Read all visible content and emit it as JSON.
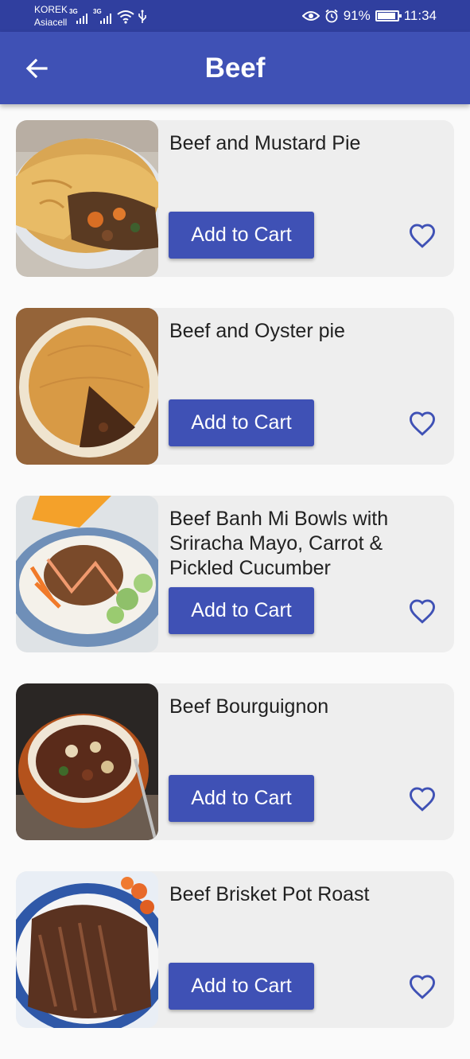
{
  "status_bar": {
    "carrier_1": "KOREK",
    "carrier_2": "Asiacell",
    "network_type": "3G",
    "battery": "91%",
    "battery_level": 0.91,
    "time": "11:34",
    "icons": [
      "signal-icon",
      "wifi-icon",
      "usb-icon",
      "eye-icon",
      "alarm-icon",
      "battery-icon"
    ]
  },
  "app_bar": {
    "title": "Beef",
    "back_icon": "arrow-left-icon"
  },
  "colors": {
    "primary": "#3f51b5",
    "primary_dark": "#303f9f",
    "card_bg": "#eeeeee",
    "page_bg": "#fafafa"
  },
  "meals": [
    {
      "name": "Beef and Mustard Pie",
      "button": "Add to Cart",
      "favorite_icon": "heart-outline-icon"
    },
    {
      "name": "Beef and Oyster pie",
      "button": "Add to Cart",
      "favorite_icon": "heart-outline-icon"
    },
    {
      "name": "Beef Banh Mi Bowls with Sriracha Mayo, Carrot & Pickled Cucumber",
      "button": "Add to Cart",
      "favorite_icon": "heart-outline-icon"
    },
    {
      "name": "Beef Bourguignon",
      "button": "Add to Cart",
      "favorite_icon": "heart-outline-icon"
    },
    {
      "name": "Beef Brisket Pot Roast",
      "button": "Add to Cart",
      "favorite_icon": "heart-outline-icon"
    }
  ]
}
